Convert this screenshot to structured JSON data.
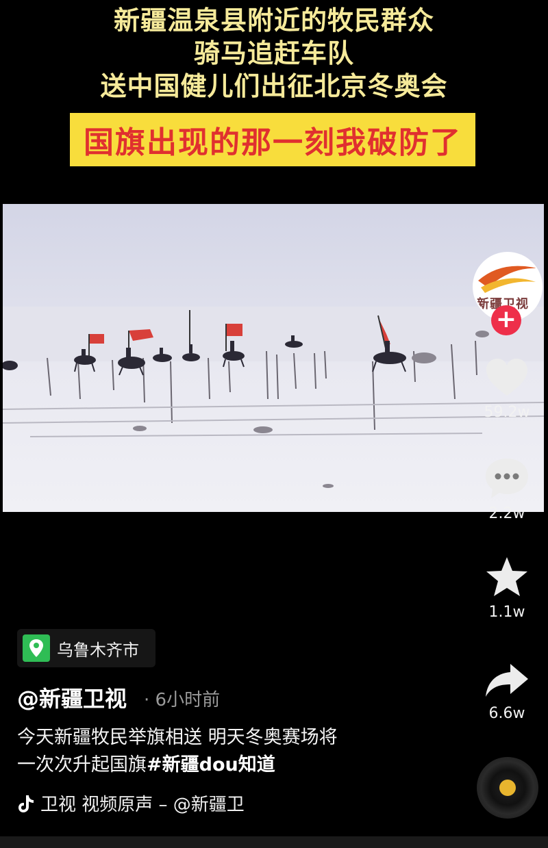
{
  "headline": {
    "line1": "新疆温泉县附近的牧民群众",
    "line2": "骑马追赶车队",
    "line3": "送中国健儿们出征北京冬奥会",
    "highlight": "国旗出现的那一刻我破防了"
  },
  "video": {
    "description": "Riders on horseback carrying red flags across a snowy field"
  },
  "side_rail": {
    "avatar_text": "新疆卫视",
    "follow_symbol": "+",
    "like_count": "59.2w",
    "comment_count": "2.2w",
    "favorite_count": "1.1w",
    "share_count": "6.6w"
  },
  "location": {
    "label": "乌鲁木齐市"
  },
  "post": {
    "author": "@新疆卫视",
    "time": "· 6小时前",
    "desc_line1": "今天新疆牧民举旗相送 明天冬奥赛场将",
    "desc_line2": "一次次升起国旗",
    "hashtag": "#新疆dou知道"
  },
  "music": {
    "text": "卫视    视频原声 – @新疆卫"
  },
  "colors": {
    "headline": "#f6ea9a",
    "highlight_bg": "#f8dd3c",
    "highlight_text": "#e0302f",
    "follow_bg": "#ee2f4a",
    "location_pin": "#2fbd55"
  }
}
